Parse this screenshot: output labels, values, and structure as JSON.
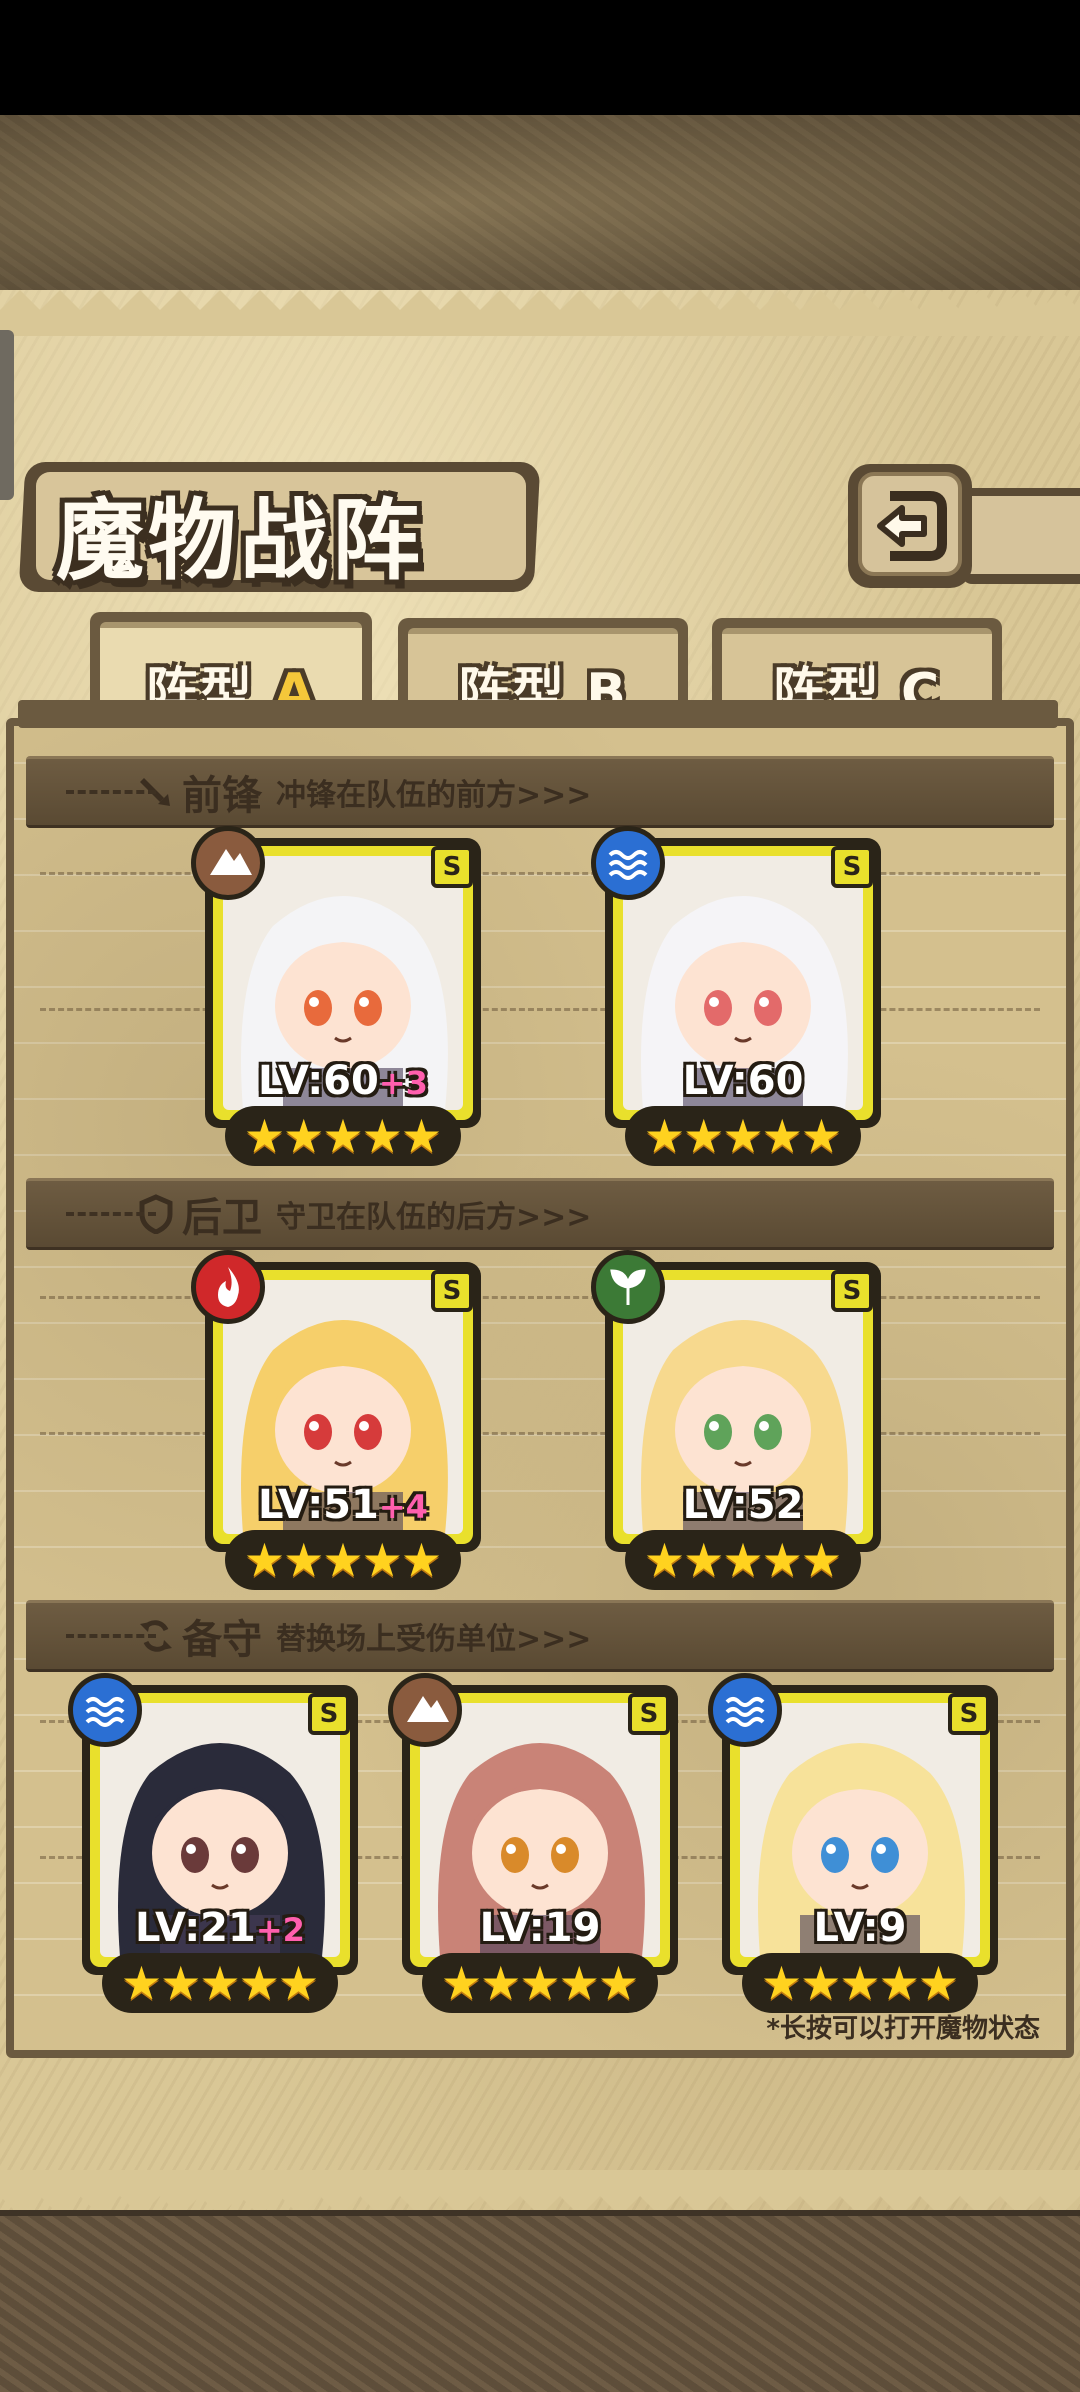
{
  "title": "魔物战阵",
  "tabs": [
    {
      "prefix": "阵型",
      "letter": "A",
      "active": true
    },
    {
      "prefix": "阵型",
      "letter": "B",
      "active": false
    },
    {
      "prefix": "阵型",
      "letter": "C",
      "active": false
    }
  ],
  "sections": {
    "front": {
      "name": "前锋",
      "desc": "冲锋在队伍的前方>>>"
    },
    "back": {
      "name": "后卫",
      "desc": "守卫在队伍的后方>>>"
    },
    "reserve": {
      "name": "备守",
      "desc": "替换场上受伤单位>>>"
    }
  },
  "cards": [
    {
      "level": "LV:60",
      "bonus": "+3",
      "rank": "S",
      "element": "earth",
      "element_color": "#8a5b3e",
      "stars": 5,
      "hair": "#f4f4f6",
      "eye": "#e86a3c"
    },
    {
      "level": "LV:60",
      "bonus": "",
      "rank": "S",
      "element": "water",
      "element_color": "#2b6fd3",
      "stars": 5,
      "hair": "#f5f4f7",
      "eye": "#e36a6a"
    },
    {
      "level": "LV:51",
      "bonus": "+4",
      "rank": "S",
      "element": "fire",
      "element_color": "#d0282a",
      "stars": 5,
      "hair": "#f6cf6a",
      "eye": "#d63b3b"
    },
    {
      "level": "LV:52",
      "bonus": "",
      "rank": "S",
      "element": "nature",
      "element_color": "#3c7a36",
      "stars": 5,
      "hair": "#f7d98e",
      "eye": "#5fa35a"
    },
    {
      "level": "LV:21",
      "bonus": "+2",
      "rank": "S",
      "element": "water",
      "element_color": "#2b6fd3",
      "stars": 5,
      "hair": "#2a2b3a",
      "eye": "#6a3a3a"
    },
    {
      "level": "LV:19",
      "bonus": "",
      "rank": "S",
      "element": "earth",
      "element_color": "#8a5b3e",
      "stars": 5,
      "hair": "#c98377",
      "eye": "#d98a2a"
    },
    {
      "level": "LV:9",
      "bonus": "",
      "rank": "S",
      "element": "water",
      "element_color": "#2b6fd3",
      "stars": 5,
      "hair": "#f7e29a",
      "eye": "#3f8fd6"
    }
  ],
  "hint": "*长按可以打开魔物状态",
  "colors": {
    "frame": "#6b5a40",
    "parchment": "#d4c08e",
    "card_gold": "#e9e02c",
    "star": "#ffd21f"
  }
}
